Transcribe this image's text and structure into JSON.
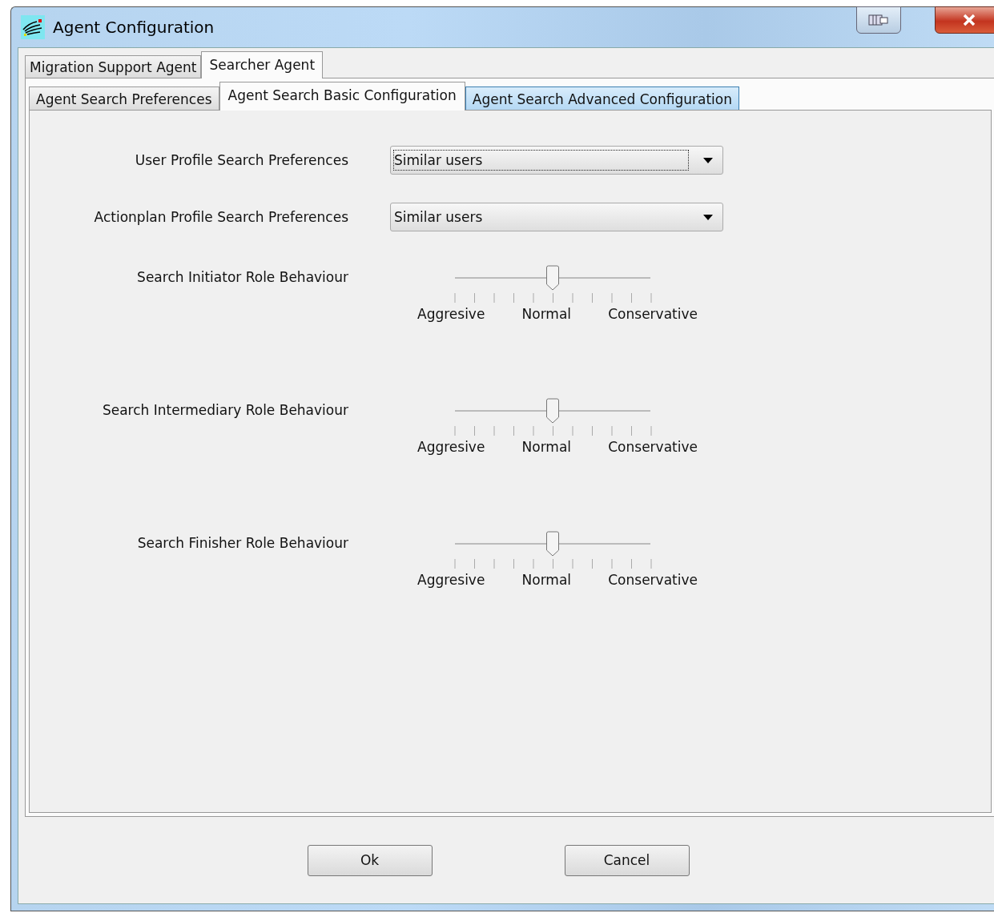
{
  "window": {
    "title": "Agent Configuration"
  },
  "tabs": [
    {
      "label": "Migration Support Agent",
      "selected": false
    },
    {
      "label": "Searcher Agent",
      "selected": true
    }
  ],
  "subtabs": [
    {
      "label": "Agent Search Preferences",
      "selected": false,
      "hovered": false
    },
    {
      "label": "Agent Search Basic Configuration",
      "selected": true,
      "hovered": false
    },
    {
      "label": "Agent Search Advanced Configuration",
      "selected": false,
      "hovered": true
    }
  ],
  "settings": [
    {
      "kind": "dropdown",
      "label": "User Profile Search Preferences",
      "value": "Similar users",
      "focused": true
    },
    {
      "kind": "dropdown",
      "label": "Actionplan Profile Search Preferences",
      "value": "Similar users",
      "focused": false
    },
    {
      "kind": "slider",
      "label": "Search Initiator Role Behaviour",
      "level": 0.5,
      "scale": [
        "Aggresive",
        "Normal",
        "Conservative"
      ]
    },
    {
      "kind": "slider",
      "label": "Search Intermediary Role Behaviour",
      "level": 0.5,
      "scale": [
        "Aggresive",
        "Normal",
        "Conservative"
      ]
    },
    {
      "kind": "slider",
      "label": "Search Finisher Role Behaviour",
      "level": 0.5,
      "scale": [
        "Aggresive",
        "Normal",
        "Conservative"
      ]
    }
  ],
  "buttons": [
    "Ok",
    "Cancel"
  ]
}
